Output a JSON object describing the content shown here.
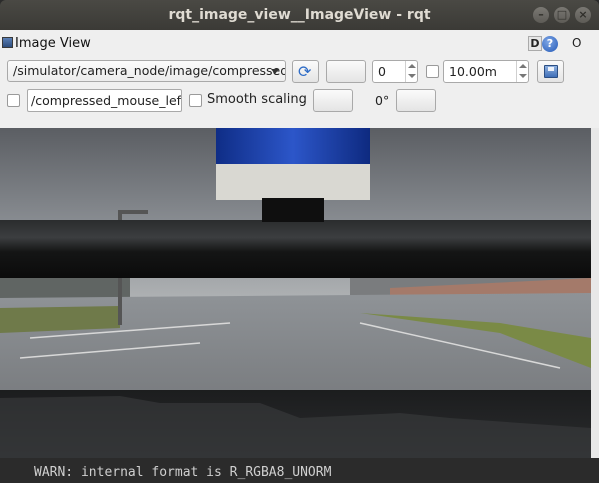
{
  "window": {
    "title": "rqt_image_view__ImageView - rqt",
    "buttons": {
      "minimize": "–",
      "maximize": "□",
      "close": "×"
    }
  },
  "plugin": {
    "title": "Image View",
    "d_label": "D",
    "help_label": "?",
    "close_label": "O"
  },
  "toolbar": {
    "topic_selected": "/simulator/camera_node/image/compressed",
    "zoom_value": "0",
    "max_value": "10.00m",
    "mouse_topic": "/compressed_mouse_left",
    "smooth_label": "Smooth scaling",
    "rotation": "0°"
  },
  "terminal": {
    "text": "WARN: internal format is R_RGBA8_UNORM"
  },
  "icons": [
    "refresh-icon",
    "save-icon",
    "image-view-icon",
    "help-icon"
  ]
}
